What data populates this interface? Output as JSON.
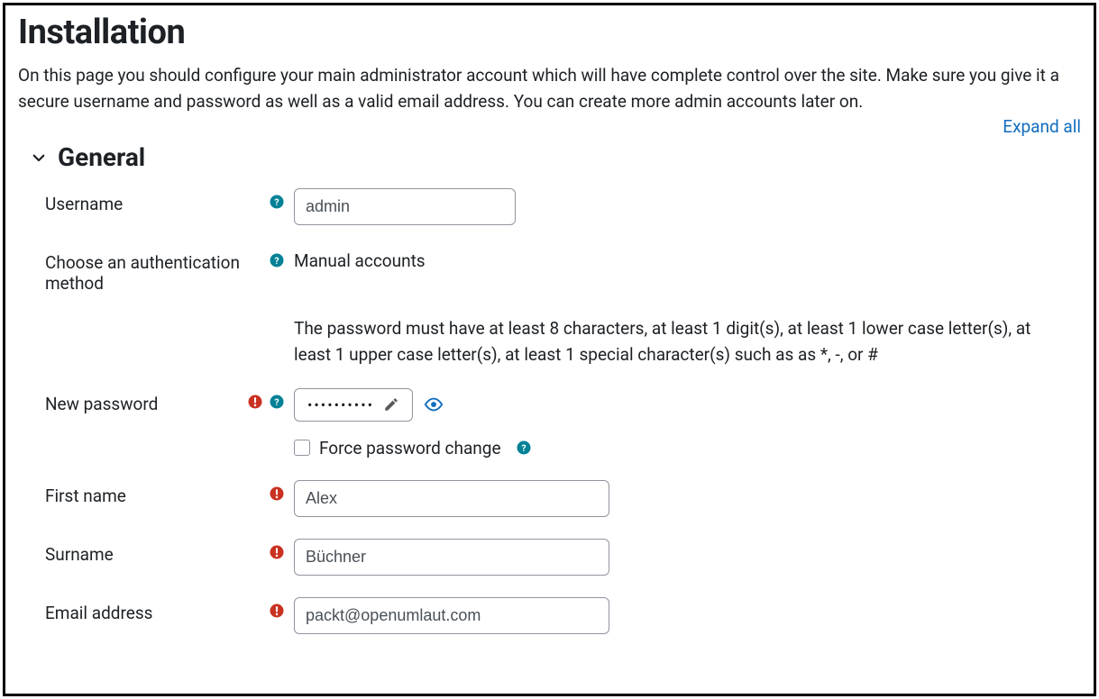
{
  "page": {
    "title": "Installation",
    "intro": "On this page you should configure your main administrator account which will have complete control over the site. Make sure you give it a secure username and password as well as a valid email address. You can create more admin accounts later on.",
    "expand_all": "Expand all"
  },
  "section": {
    "title": "General"
  },
  "fields": {
    "username": {
      "label": "Username",
      "value": "admin"
    },
    "auth_method": {
      "label": "Choose an authentication method",
      "value": "Manual accounts"
    },
    "password_hint": "The password must have at least 8 characters, at least 1 digit(s), at least 1 lower case letter(s), at least 1 upper case letter(s), at least 1 special character(s) such as as *, -, or #",
    "new_password": {
      "label": "New password",
      "masked": "••••••••••"
    },
    "force_change": {
      "label": "Force password change"
    },
    "firstname": {
      "label": "First name",
      "value": "Alex"
    },
    "surname": {
      "label": "Surname",
      "value": "Büchner"
    },
    "email": {
      "label": "Email address",
      "value": "packt@openumlaut.com"
    }
  },
  "colors": {
    "link": "#0f6cbf",
    "help_icon": "#008196",
    "required_icon": "#ca3120",
    "eye_icon": "#0f6cbf"
  }
}
